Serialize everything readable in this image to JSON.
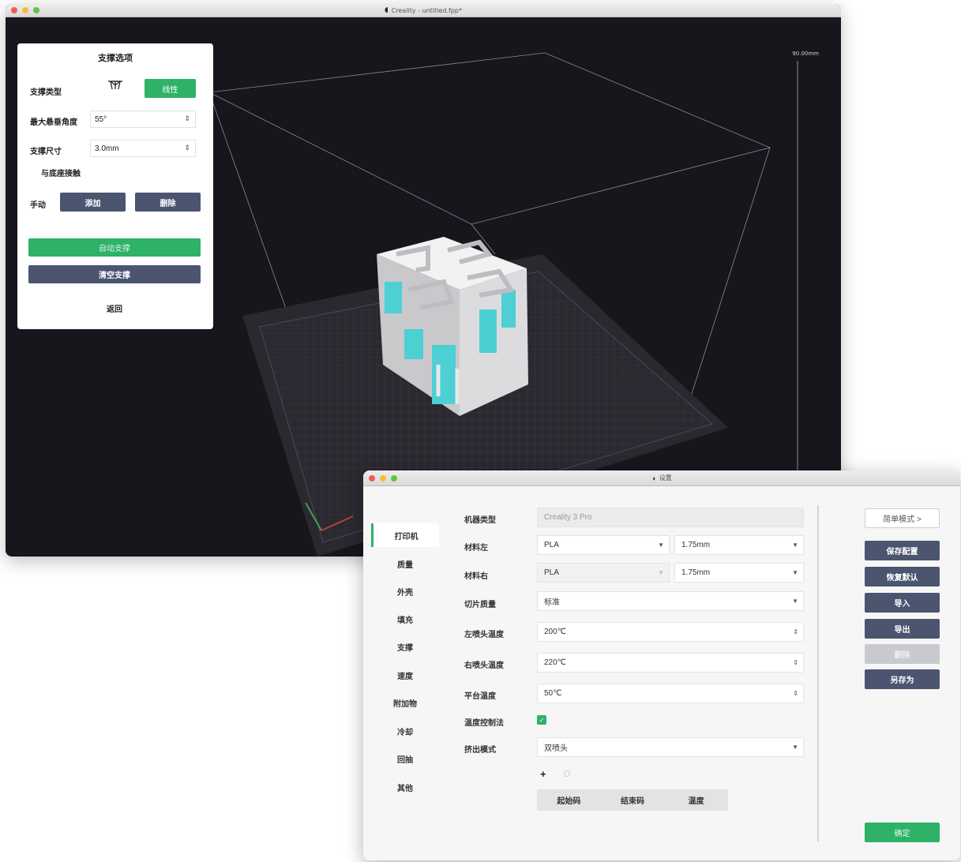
{
  "main_window": {
    "title": "Creality - untitled.fpp*",
    "height_label": "90.00mm"
  },
  "support_panel": {
    "title": "支撑选项",
    "support_type_label": "支撑类型",
    "support_type_icon": "tree-support-icon",
    "support_type_active": "线性",
    "angle_label": "最大悬垂角度",
    "angle_value": "55°",
    "size_label": "支撑尺寸",
    "size_value": "3.0mm",
    "platform_label": "与底座接触",
    "manual_label": "手动",
    "add_label": "添加",
    "delete_label": "删除",
    "auto_label": "自动支撑",
    "clear_label": "清空支撑",
    "back_label": "返回"
  },
  "settings_window": {
    "title": "设置",
    "sidebar": [
      "打印机",
      "质量",
      "外壳",
      "填充",
      "支撑",
      "速度",
      "附加物",
      "冷却",
      "回抽",
      "其他"
    ],
    "active_index": 0,
    "rows": {
      "machine_type": {
        "label": "机器类型",
        "value": "Creality 3 Pro"
      },
      "material_left": {
        "label": "材料左",
        "value": "PLA",
        "diameter": "1.75mm"
      },
      "material_right": {
        "label": "材料右",
        "value": "PLA",
        "diameter": "1.75mm"
      },
      "slice_quality": {
        "label": "切片质量",
        "value": "标准"
      },
      "left_nozzle_temp": {
        "label": "左喷头温度",
        "value": "200℃"
      },
      "right_nozzle_temp": {
        "label": "右喷头温度",
        "value": "220℃"
      },
      "bed_temp": {
        "label": "平台温度",
        "value": "50℃"
      },
      "temp_control": {
        "label": "温度控制法"
      },
      "extruder_mode": {
        "label": "挤出模式",
        "value": "双喷头"
      }
    },
    "gcode_tabs": [
      "起始码",
      "结束码",
      "温度"
    ],
    "buttons": {
      "simple_mode": "简单模式 >",
      "save_config": "保存配置",
      "restore_default": "恢复默认",
      "import": "导入",
      "export": "导出",
      "delete": "删除",
      "save_as": "另存为",
      "ok": "确定"
    }
  }
}
